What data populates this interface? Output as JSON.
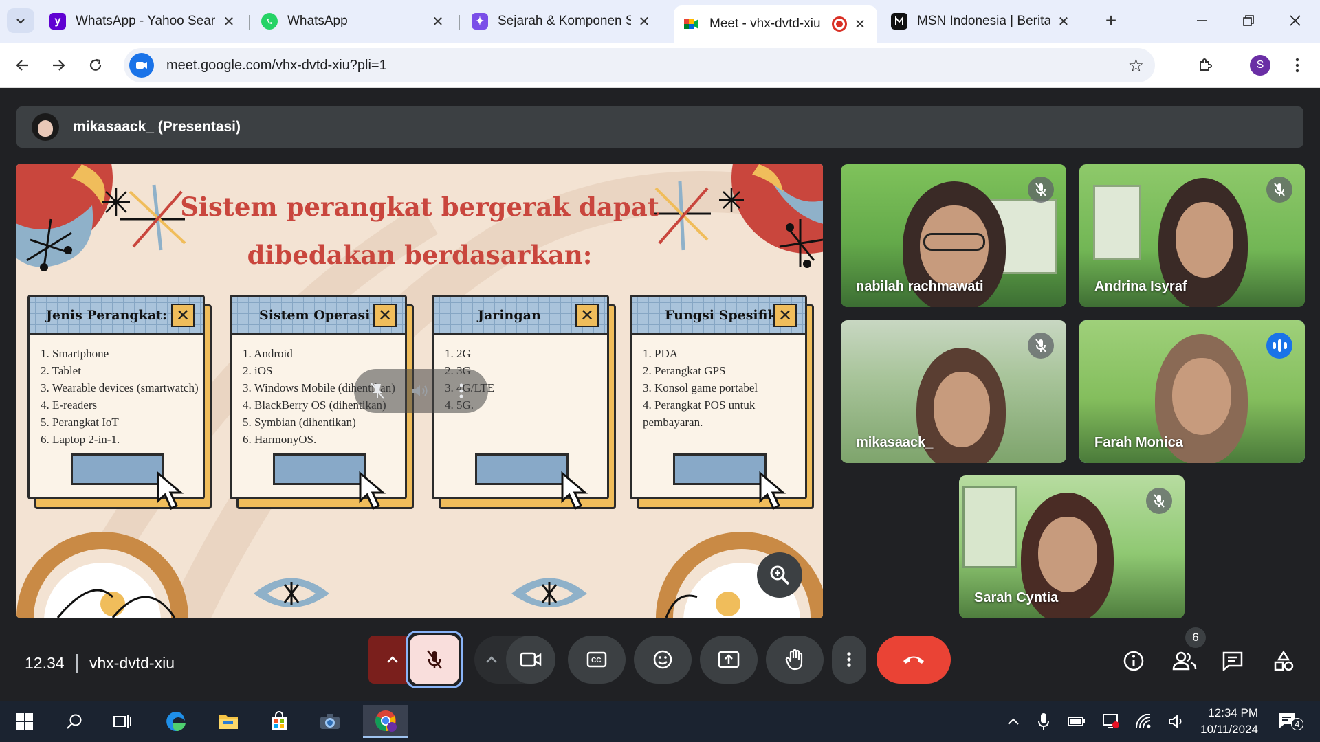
{
  "browser": {
    "tabs": [
      {
        "label": "WhatsApp - Yahoo Search",
        "icon": "yahoo-icon",
        "color": "#6001d2"
      },
      {
        "label": "WhatsApp",
        "icon": "whatsapp-icon",
        "color": "#25d366"
      },
      {
        "label": "Sejarah & Komponen Sist",
        "icon": "copilot-icon",
        "color": "#7a4ee8"
      },
      {
        "label": "Meet - vhx-dvtd-xiu",
        "icon": "meet-icon",
        "color": "#00897b"
      },
      {
        "label": "MSN Indonesia | Berita Te",
        "icon": "msn-icon",
        "color": "#111111"
      }
    ],
    "url": "meet.google.com/vhx-dvtd-xiu?pli=1",
    "profile_initial": "S"
  },
  "presentation": {
    "presenter": "mikasaack_ (Presentasi)"
  },
  "slide": {
    "title_line1": "Sistem perangkat bergerak dapat",
    "title_line2": "dibedakan berdasarkan:",
    "cards": [
      {
        "title": "Jenis Perangkat:",
        "items": [
          "1. Smartphone",
          "2. Tablet",
          "3. Wearable devices (smartwatch)",
          "4. E-readers",
          "5. Perangkat IoT",
          "6. Laptop 2-in-1."
        ]
      },
      {
        "title": "Sistem Operasi",
        "items": [
          "1. Android",
          "2. iOS",
          "3. Windows Mobile (dihentikan)",
          "4. BlackBerry OS (dihentikan)",
          "5. Symbian (dihentikan)",
          "6. HarmonyOS."
        ]
      },
      {
        "title": "Jaringan",
        "items": [
          "1. 2G",
          "2. 3G",
          "3. 4G/LTE",
          "4. 5G."
        ]
      },
      {
        "title": "Fungsi Spesifik",
        "items": [
          "1. PDA",
          "2. Perangkat GPS",
          "3. Konsol game portabel",
          "4. Perangkat POS untuk",
          "pembayaran."
        ]
      }
    ]
  },
  "participants": [
    {
      "name": "nabilah rachmawati",
      "muted": true
    },
    {
      "name": "Andrina Isyraf",
      "muted": true
    },
    {
      "name": "mikasaack_",
      "muted": true
    },
    {
      "name": "Farah Monica",
      "muted": false,
      "speaking": true
    },
    {
      "name": "Sarah Cyntia",
      "muted": true
    }
  ],
  "meeting": {
    "time": "12.34",
    "code": "vhx-dvtd-xiu",
    "people_count": "6",
    "end_color": "#ea4335"
  },
  "taskbar": {
    "time": "12:34 PM",
    "date": "10/11/2024",
    "notification_count": "4"
  }
}
